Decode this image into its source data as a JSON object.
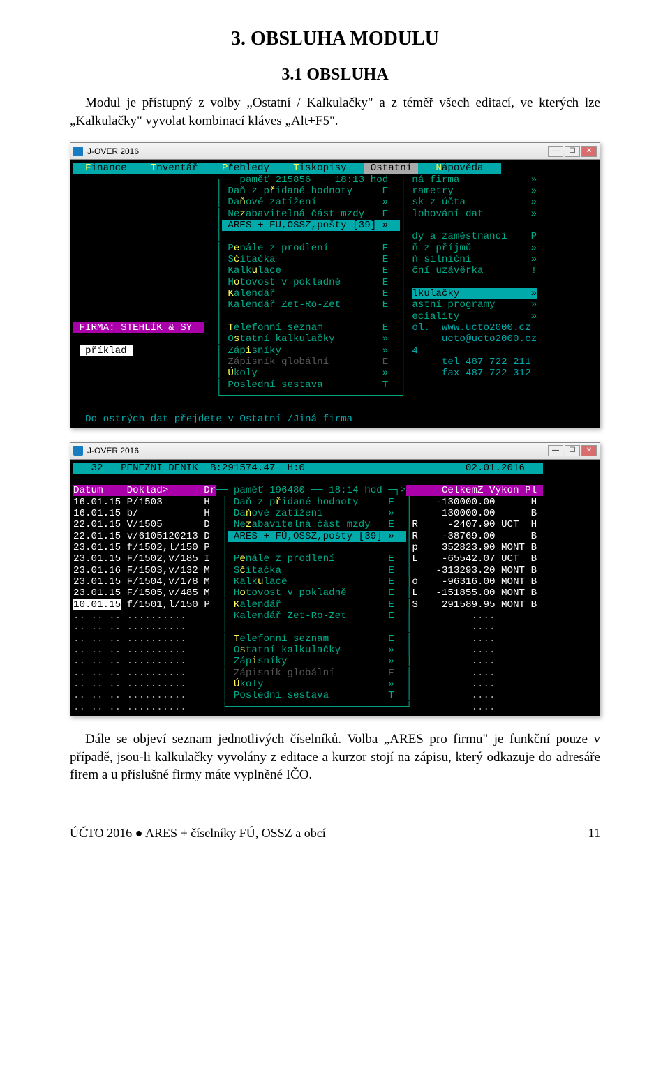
{
  "title": "3. OBSLUHA MODULU",
  "subtitle": "3.1 OBSLUHA",
  "para1": "Modul je přístupný z volby „Ostatní / Kalkulačky\" a z téměř všech editací, ve kterých lze „Kalkulačky\" vyvolat kombinací kláves „Alt+F5\".",
  "para2": "Dále se objeví seznam jednotlivých číselníků. Volba „ARES pro firmu\" je funkční pouze v případě, jsou-li kalkulačky vyvolány z editace a kurzor stojí na zápisu, který odkazuje do adresáře firem a u příslušné firmy máte vyplněné IČO.",
  "window_title": "J-OVER 2016",
  "win1": {
    "menu": "  Finance    Inventář    Přehledy    Tiskopisy    Ostatní    Nápověda",
    "mem_line": "── paměť 215856 ── 18:13 hod ─┐",
    "right_menu": [
      {
        "label": "ná firma",
        "sc": "»"
      },
      {
        "label": "rametry",
        "sc": "»"
      },
      {
        "label": "sk z účta",
        "sc": "»"
      },
      {
        "label": "lohování dat",
        "sc": "»"
      },
      {
        "label": "",
        "sc": ""
      },
      {
        "label": "dy a zaměstnanci",
        "sc": "P"
      },
      {
        "label": "ň z příjmů",
        "sc": "»"
      },
      {
        "label": "ň silniční",
        "sc": "»"
      },
      {
        "label": "ční uzávěrka",
        "sc": "!"
      },
      {
        "label": "",
        "sc": ""
      },
      {
        "label": "lkulačky",
        "sc": "»"
      },
      {
        "label": "astní programy",
        "sc": "»"
      },
      {
        "label": "eciality",
        "sc": "»"
      }
    ],
    "left_menu": [
      {
        "label": "Daň z přidané hodnoty",
        "sc": "E",
        "hi": "ř"
      },
      {
        "label": "Daňové zatížení",
        "sc": "»",
        "hi": "ň"
      },
      {
        "label": "Nezabavitelná část mzdy",
        "sc": "E",
        "hi": "z"
      },
      {
        "label": "ARES + FÚ,OSSZ,pošty [39]",
        "sc": "»",
        "sel": true
      },
      {
        "label": "",
        "sc": ""
      },
      {
        "label": "Penále z prodlení",
        "sc": "E",
        "hi": "e"
      },
      {
        "label": "Sčítačka",
        "sc": "E",
        "hi": "č"
      },
      {
        "label": "Kalkulace",
        "sc": "E",
        "hi": "u"
      },
      {
        "label": "Hotovost v pokladně",
        "sc": "E",
        "hi": "o"
      },
      {
        "label": "Kalendář",
        "sc": "E",
        "hi": "K"
      },
      {
        "label": "Kalendář Zet-Ro-Zet",
        "sc": "E"
      },
      {
        "label": "",
        "sc": ""
      },
      {
        "label": "Telefonní seznam",
        "sc": "E",
        "hi": "T"
      },
      {
        "label": "Ostatní kalkulačky",
        "sc": "»",
        "hi": "s"
      },
      {
        "label": "Zápisníky",
        "sc": "»",
        "hi": "i"
      },
      {
        "label": "Zápisník globální",
        "sc": "E",
        "dim": true
      },
      {
        "label": "Úkoly",
        "sc": "»",
        "hi": "Ú"
      },
      {
        "label": "Poslední sestava",
        "sc": "T"
      }
    ],
    "firma_label": "FIRMA: STEHLÍK & SY",
    "priklad": "příklad",
    "bottom_help": "  Do ostrých dat přejdete v Ostatní /Jiná firma",
    "right_info": [
      "ol.  www.ucto2000.cz",
      "     ucto@ucto2000.cz",
      "4",
      "     tel 487 722 211",
      "     fax 487 722 312"
    ]
  },
  "win2": {
    "top": "   32   PENĚŽNÍ DENÍK  B:291574.47  H:0                           02.01.2016",
    "header": "Datum    Doklad>      Dr",
    "header_r": "      CelkemZ Výkon Pl",
    "mem": "── paměť 196480 ── 18:14 hod ─┐>",
    "rows": [
      {
        "d": "16.01.15",
        "dok": "P/1503",
        "dr": "H",
        "r": "",
        "amt": "-130000.00",
        "vk": "",
        "pl": "H"
      },
      {
        "d": "16.01.15",
        "dok": "b/",
        "dr": "H",
        "r": "",
        "amt": "130000.00",
        "vk": "",
        "pl": "B"
      },
      {
        "d": "22.01.15",
        "dok": "V/1505",
        "dr": "D",
        "r": "R",
        "amt": "-2407.90",
        "vk": "UCT",
        "pl": "H"
      },
      {
        "d": "22.01.15",
        "dok": "v/6105120213",
        "dr": "D",
        "r": "R",
        "amt": "-38769.00",
        "vk": "",
        "pl": "B"
      },
      {
        "d": "23.01.15",
        "dok": "f/1502,l/150",
        "dr": "P",
        "r": "p",
        "amt": "352823.90",
        "vk": "MONT",
        "pl": "B"
      },
      {
        "d": "23.01.15",
        "dok": "F/1502,v/185",
        "dr": "I",
        "r": "L",
        "amt": "-65542.07",
        "vk": "UCT",
        "pl": "B"
      },
      {
        "d": "23.01.16",
        "dok": "F/1503,v/132",
        "dr": "M",
        "r": "",
        "amt": "-313293.20",
        "vk": "MONT",
        "pl": "B"
      },
      {
        "d": "23.01.15",
        "dok": "F/1504,v/178",
        "dr": "M",
        "r": "o",
        "amt": "-96316.00",
        "vk": "MONT",
        "pl": "B"
      },
      {
        "d": "23.01.15",
        "dok": "F/1505,v/485",
        "dr": "M",
        "r": "L",
        "amt": "-151855.00",
        "vk": "MONT",
        "pl": "B"
      },
      {
        "d": "10.01.15",
        "dok": "f/1501,l/150",
        "dr": "P",
        "r": "S",
        "amt": "291589.95",
        "vk": "MONT",
        "pl": "B",
        "sel": true
      }
    ],
    "popup": [
      {
        "label": "Daň z přidané hodnoty",
        "sc": "E",
        "hi": "ř"
      },
      {
        "label": "Daňové zatížení",
        "sc": "»",
        "hi": "ň"
      },
      {
        "label": "Nezabavitelná část mzdy",
        "sc": "E",
        "hi": "z"
      },
      {
        "label": "ARES + FÚ,OSSZ,pošty [39]",
        "sc": "»",
        "sel": true
      },
      {
        "label": "",
        "sc": ""
      },
      {
        "label": "Penále z prodlení",
        "sc": "E",
        "hi": "e"
      },
      {
        "label": "Sčítačka",
        "sc": "E",
        "hi": "č"
      },
      {
        "label": "Kalkulace",
        "sc": "E",
        "hi": "u"
      },
      {
        "label": "Hotovost v pokladně",
        "sc": "E",
        "hi": "o"
      },
      {
        "label": "Kalendář",
        "sc": "E",
        "hi": "K"
      },
      {
        "label": "Kalendář Zet-Ro-Zet",
        "sc": "E"
      },
      {
        "label": "",
        "sc": ""
      },
      {
        "label": "Telefonní seznam",
        "sc": "E",
        "hi": "T"
      },
      {
        "label": "Ostatní kalkulačky",
        "sc": "»",
        "hi": "s"
      },
      {
        "label": "Zápisníky",
        "sc": "»",
        "hi": "i"
      },
      {
        "label": "Zápisník globální",
        "sc": "E",
        "dim": true
      },
      {
        "label": "Úkoly",
        "sc": "»",
        "hi": "Ú"
      },
      {
        "label": "Poslední sestava",
        "sc": "T"
      }
    ]
  },
  "footer_left": "ÚČTO 2016 ● ARES + číselníky FÚ, OSSZ a obcí",
  "footer_right": "11"
}
